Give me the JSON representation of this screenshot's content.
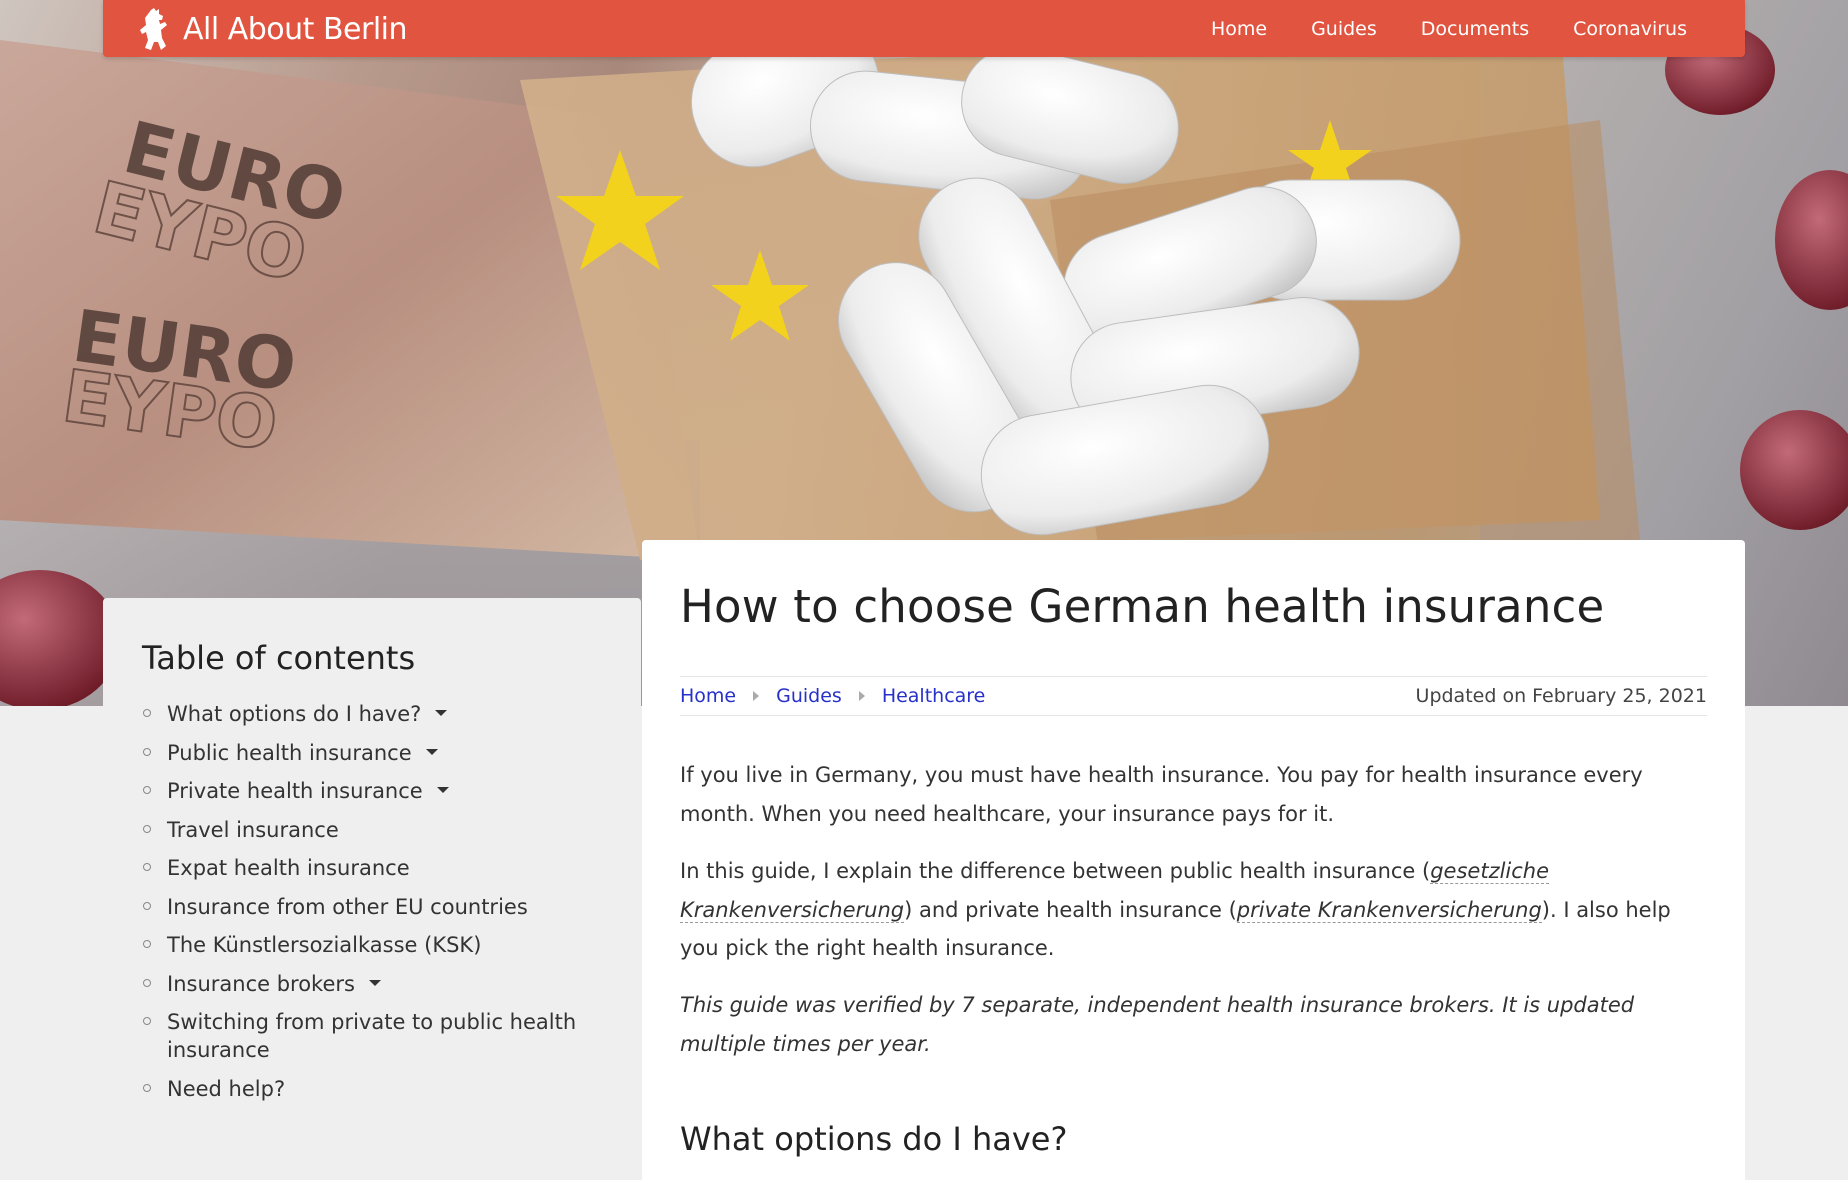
{
  "nav": {
    "brand": "All About Berlin",
    "links": [
      "Home",
      "Guides",
      "Documents",
      "Coronavirus"
    ]
  },
  "hero": {
    "banknote_text": [
      "EURO",
      "EYPO",
      "EURO",
      "EYPO"
    ]
  },
  "toc": {
    "title": "Table of contents",
    "items": [
      {
        "label": "What options do I have?",
        "expandable": true
      },
      {
        "label": "Public health insurance",
        "expandable": true
      },
      {
        "label": "Private health insurance",
        "expandable": true
      },
      {
        "label": "Travel insurance",
        "expandable": false
      },
      {
        "label": "Expat health insurance",
        "expandable": false
      },
      {
        "label": "Insurance from other EU countries",
        "expandable": false
      },
      {
        "label": "The Künstlersozialkasse (KSK)",
        "expandable": false
      },
      {
        "label": "Insurance brokers",
        "expandable": true
      },
      {
        "label": "Switching from private to public health insurance",
        "expandable": false
      },
      {
        "label": "Need help?",
        "expandable": false
      }
    ]
  },
  "article": {
    "title": "How to choose German health insurance",
    "breadcrumbs": [
      "Home",
      "Guides",
      "Healthcare"
    ],
    "updated": "Updated on February 25, 2021",
    "intro": "If you live in Germany, you must have health insurance. You pay for health insurance every month. When you need healthcare, your insurance pays for it.",
    "guide_text_1": "In this guide, I explain the difference between public health insurance (",
    "term_public": "gesetzliche Krankenversicherung",
    "guide_text_2": ") and private health insurance (",
    "term_private": "private Krankenversicherung",
    "guide_text_3": "). I also help you pick the right health insurance.",
    "verified": "This guide was verified by 7 separate, independent health insurance brokers. It is updated multiple times per year.",
    "section_heading": "What options do I have?"
  },
  "colors": {
    "nav_bg": "#e05440",
    "link": "#2730c9",
    "page_bg": "#efefef"
  }
}
